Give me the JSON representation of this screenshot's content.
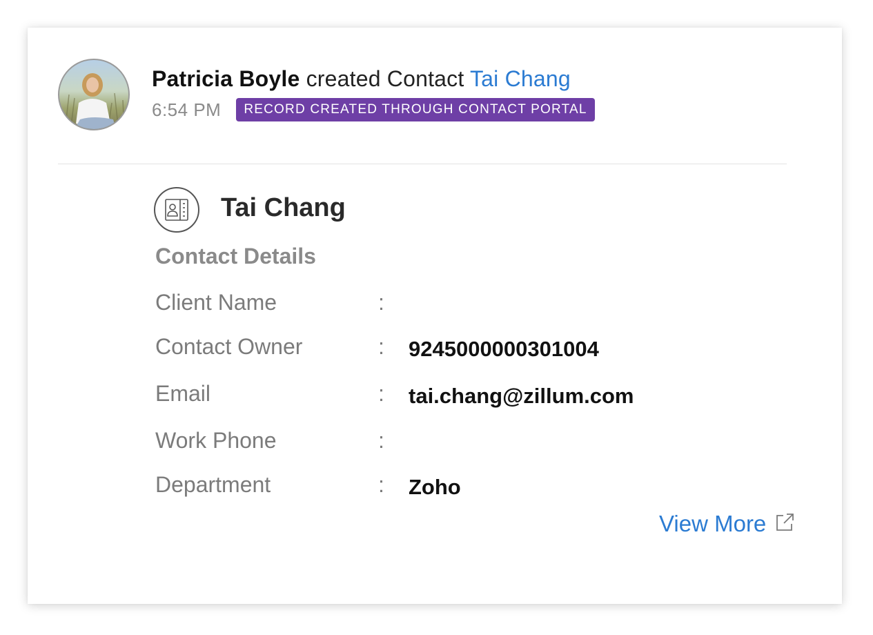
{
  "activity": {
    "actor": "Patricia Boyle",
    "action": "created Contact",
    "record_link": "Tai Chang",
    "time": "6:54 PM",
    "badge": "RECORD CREATED THROUGH CONTACT PORTAL",
    "badge_color": "#6e3fa6",
    "link_color": "#2b7bd2"
  },
  "record": {
    "icon": "contact-card-icon",
    "title": "Tai Chang",
    "section_title": "Contact Details",
    "fields": [
      {
        "label": "Client Name",
        "colon": ":",
        "value": ""
      },
      {
        "label": "Contact Owner",
        "colon": ":",
        "value": "9245000000301004"
      },
      {
        "label": "Email",
        "colon": ":",
        "value": "tai.chang@zillum.com"
      },
      {
        "label": "Work Phone",
        "colon": ":",
        "value": ""
      },
      {
        "label": "Department",
        "colon": ":",
        "value": "Zoho"
      }
    ]
  },
  "view_more": {
    "label": "View More",
    "icon": "external-link-icon"
  }
}
